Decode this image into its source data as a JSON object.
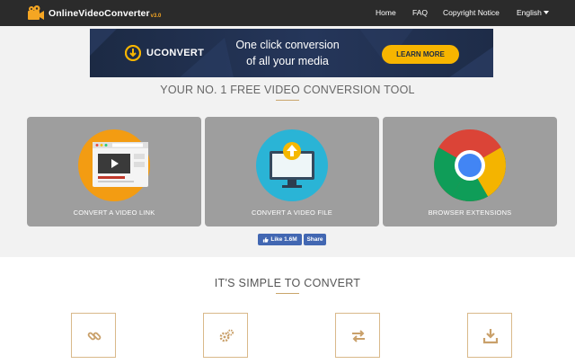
{
  "nav": {
    "brand": "OnlineVideoConverter",
    "version": "v3.0",
    "links": [
      {
        "label": "Home"
      },
      {
        "label": "FAQ"
      },
      {
        "label": "Copyright Notice"
      }
    ],
    "language": "English"
  },
  "banner": {
    "brand": "UCONVERT",
    "tagline_line1": "One click conversion",
    "tagline_line2": "of all your media",
    "cta": "LEARN MORE"
  },
  "main_title": "YOUR NO. 1 FREE VIDEO CONVERSION TOOL",
  "cards": [
    {
      "label": "CONVERT A VIDEO LINK",
      "icon": "video-link-icon"
    },
    {
      "label": "CONVERT A VIDEO FILE",
      "icon": "upload-file-icon"
    },
    {
      "label": "BROWSER EXTENSIONS",
      "icon": "chrome-icon"
    }
  ],
  "facebook": {
    "like_label": "Like 1.6M",
    "share_label": "Share"
  },
  "simple_title": "IT'S SIMPLE TO CONVERT",
  "steps": [
    {
      "icon": "link-icon"
    },
    {
      "icon": "gears-icon"
    },
    {
      "icon": "convert-arrows-icon"
    },
    {
      "icon": "download-icon"
    }
  ],
  "colors": {
    "navbar": "#2b2b2b",
    "accent": "#f5a623",
    "card_bg": "#9e9e9e",
    "facebook": "#4267b2",
    "step_border": "#d9b98a"
  }
}
